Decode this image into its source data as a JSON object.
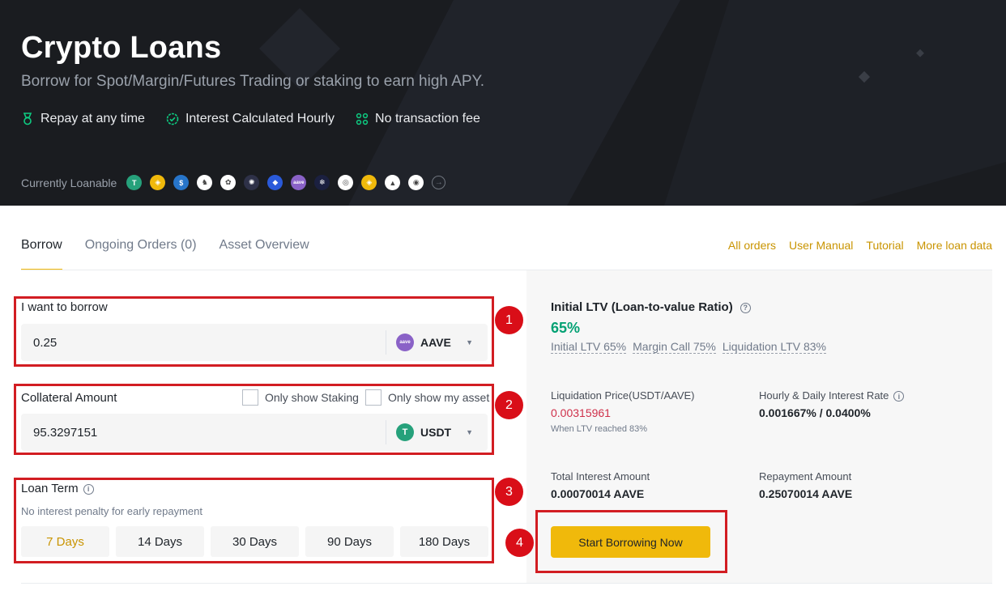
{
  "hero": {
    "title": "Crypto Loans",
    "subtitle": "Borrow for Spot/Margin/Futures Trading or staking to earn high APY.",
    "features": [
      {
        "label": "Repay at any time",
        "icon": "medal-icon"
      },
      {
        "label": "Interest Calculated Hourly",
        "icon": "badge-check-icon"
      },
      {
        "label": "No transaction fee",
        "icon": "nodes-icon"
      }
    ],
    "loanable_label": "Currently Loanable",
    "coins": [
      {
        "icon": "usdt-coin-icon",
        "color": "#26a17b",
        "glyph": "T"
      },
      {
        "icon": "busd-coin-icon",
        "color": "#f0b90b",
        "glyph": "◈"
      },
      {
        "icon": "usdc-coin-icon",
        "color": "#2775ca",
        "glyph": "$"
      },
      {
        "icon": "unicorn-coin-icon",
        "color": "#ffffff",
        "glyph": "♞"
      },
      {
        "icon": "flower-coin-icon",
        "color": "#ffffff",
        "glyph": "✿"
      },
      {
        "icon": "atom-coin-icon",
        "color": "#2e3148",
        "glyph": "✺"
      },
      {
        "icon": "diamond-coin-icon",
        "color": "#2a5ada",
        "glyph": "◆"
      },
      {
        "icon": "aave-coin-icon",
        "color": "#8a62c7",
        "glyph": "aave"
      },
      {
        "icon": "snowflake-coin-icon",
        "color": "#1b2040",
        "glyph": "❄"
      },
      {
        "icon": "ring-coin-icon",
        "color": "#ffffff",
        "glyph": "◎"
      },
      {
        "icon": "bnb-coin-icon",
        "color": "#f0b90b",
        "glyph": "◈"
      },
      {
        "icon": "avax-coin-icon",
        "color": "#ffffff",
        "glyph": "▲"
      },
      {
        "icon": "bottle-coin-icon",
        "color": "#ffffff",
        "glyph": "◉"
      }
    ]
  },
  "tabs": [
    {
      "label": "Borrow"
    },
    {
      "label": "Ongoing Orders (0)"
    },
    {
      "label": "Asset Overview"
    }
  ],
  "links": [
    "All orders",
    "User Manual",
    "Tutorial",
    "More loan data"
  ],
  "borrow": {
    "label": "I want to borrow",
    "value": "0.25",
    "asset": "AAVE"
  },
  "collateral": {
    "label": "Collateral Amount",
    "value": "95.3297151",
    "asset": "USDT",
    "only_staking": "Only show Staking",
    "only_my_asset": "Only show my asset"
  },
  "loan_term": {
    "label": "Loan Term",
    "note": "No interest penalty for early repayment",
    "options": [
      "7 Days",
      "14 Days",
      "30 Days",
      "90 Days",
      "180 Days"
    ],
    "selected": "7 Days"
  },
  "panel": {
    "ltv_title": "Initial LTV (Loan-to-value Ratio)",
    "ltv_value": "65%",
    "ltv_links": [
      "Initial LTV 65%",
      "Margin Call 75%",
      "Liquidation LTV 83%"
    ],
    "liq_price_label": "Liquidation Price(USDT/AAVE)",
    "liq_price_value": "0.00315961",
    "liq_price_note": "When LTV reached 83%",
    "rate_label": "Hourly & Daily Interest Rate",
    "rate_value": "0.001667% / 0.0400%",
    "total_interest_label": "Total Interest Amount",
    "total_interest_value": "0.00070014 AAVE",
    "repayment_label": "Repayment Amount",
    "repayment_value": "0.25070014 AAVE",
    "start_button": "Start Borrowing Now"
  },
  "annotations": [
    "1",
    "2",
    "3",
    "4"
  ],
  "colors": {
    "hero_bg": "#1a1c20",
    "accent": "#f0b90b",
    "link": "#c99400",
    "green": "#02a173",
    "red": "#cf304a",
    "annotation": "#d21d22"
  }
}
